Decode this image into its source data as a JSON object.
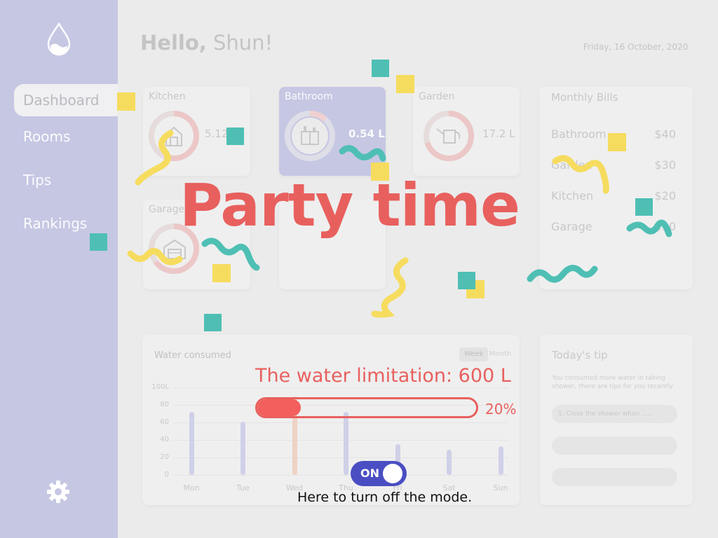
{
  "sidebar": {
    "items": [
      {
        "label": "Dashboard",
        "active": true
      },
      {
        "label": "Rooms",
        "active": false
      },
      {
        "label": "Tips",
        "active": false
      },
      {
        "label": "Rankings",
        "active": false
      }
    ],
    "logo_icon": "water-drop-icon",
    "settings_icon": "gear-icon"
  },
  "header": {
    "greeting": "Hello,",
    "name": " Shun!",
    "date": "Friday, 16 October, 2020"
  },
  "rooms": [
    {
      "name": "Kitchen",
      "value": "5.12",
      "icon": "house-icon",
      "level": 0.55
    },
    {
      "name": "Bathroom",
      "value": "0.54 L",
      "icon": "bathroom-cabinet-icon",
      "level": 0.12,
      "active": true
    },
    {
      "name": "Garden",
      "value": "17.2 L",
      "icon": "watering-can-icon",
      "level": 0.7
    },
    {
      "name": "Garage",
      "value": "",
      "icon": "garage-icon",
      "level": 0.65
    }
  ],
  "bills": {
    "title": "Monthly Bills",
    "rows": [
      {
        "room": "Bathroom",
        "amount": "$40"
      },
      {
        "room": "Garden",
        "amount": "$30"
      },
      {
        "room": "Kitchen",
        "amount": "$20"
      },
      {
        "room": "Garage",
        "amount": "$10"
      }
    ]
  },
  "water": {
    "title": "Water consumed",
    "toggle": {
      "week": "Week",
      "month": "Month"
    }
  },
  "chart_data": {
    "type": "bar",
    "title": "Water consumed",
    "categories": [
      "Mon",
      "Tue",
      "Wed",
      "Thu",
      "Fri",
      "Sat",
      "Sun"
    ],
    "values": [
      72,
      61,
      90,
      72,
      35,
      29,
      33
    ],
    "highlight": "Wed",
    "yticks": [
      "100L",
      "80",
      "60",
      "40",
      "20",
      "0"
    ],
    "ylim": [
      0,
      100
    ],
    "colors": {
      "bar": "#cfd0e8",
      "highlight": "#eed2c4"
    }
  },
  "tip": {
    "title": "Today's tip",
    "text": "You consumed more water in taking shower, there are tips for you recently",
    "items": [
      "1. Close the shower when ......",
      "",
      ""
    ]
  },
  "party": {
    "title": "Party time",
    "limit_text": "The water limitation: 600 L",
    "progress_label": "20%",
    "progress": 0.2,
    "toggle_label": "ON",
    "hint": "Here to turn off the mode."
  },
  "colors": {
    "sidebar": "#c6c7e3",
    "accent_red": "#e8605e",
    "toggle_blue": "#4a4ec2",
    "confetti_yellow": "#f6dc5e",
    "confetti_teal": "#4fbfb4"
  }
}
